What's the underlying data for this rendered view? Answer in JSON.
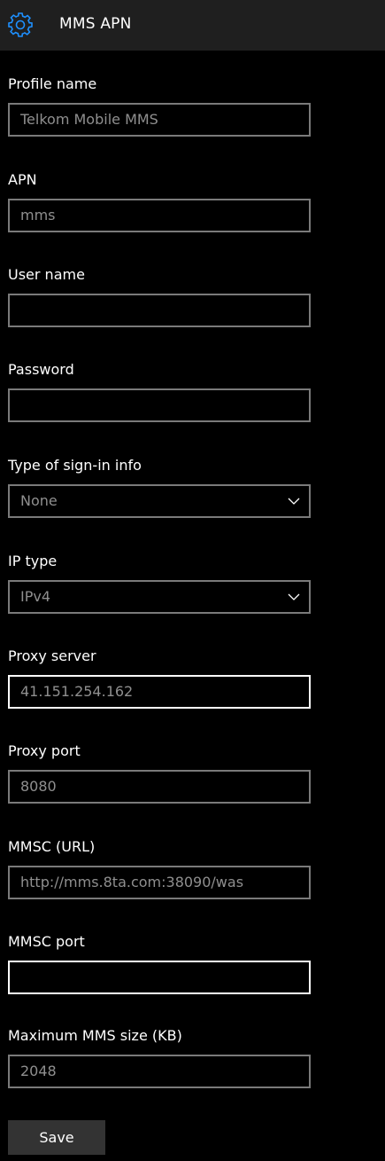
{
  "header": {
    "title": "MMS APN",
    "icon": "gear-icon",
    "accent_color": "#1e90ff"
  },
  "fields": {
    "profile_name": {
      "label": "Profile name",
      "value": "Telkom Mobile MMS"
    },
    "apn": {
      "label": "APN",
      "value": "mms"
    },
    "user_name": {
      "label": "User name",
      "value": ""
    },
    "password": {
      "label": "Password",
      "value": ""
    },
    "sign_in_type": {
      "label": "Type of sign-in info",
      "value": "None"
    },
    "ip_type": {
      "label": "IP type",
      "value": "IPv4"
    },
    "proxy_server": {
      "label": "Proxy server",
      "value": "41.151.254.162"
    },
    "proxy_port": {
      "label": "Proxy port",
      "value": "8080"
    },
    "mmsc_url": {
      "label": "MMSC (URL)",
      "value": "http://mms.8ta.com:38090/was"
    },
    "mmsc_port": {
      "label": "MMSC port",
      "value": ""
    },
    "max_mms_size": {
      "label": "Maximum MMS size (KB)",
      "value": "2048"
    }
  },
  "actions": {
    "save_label": "Save"
  }
}
